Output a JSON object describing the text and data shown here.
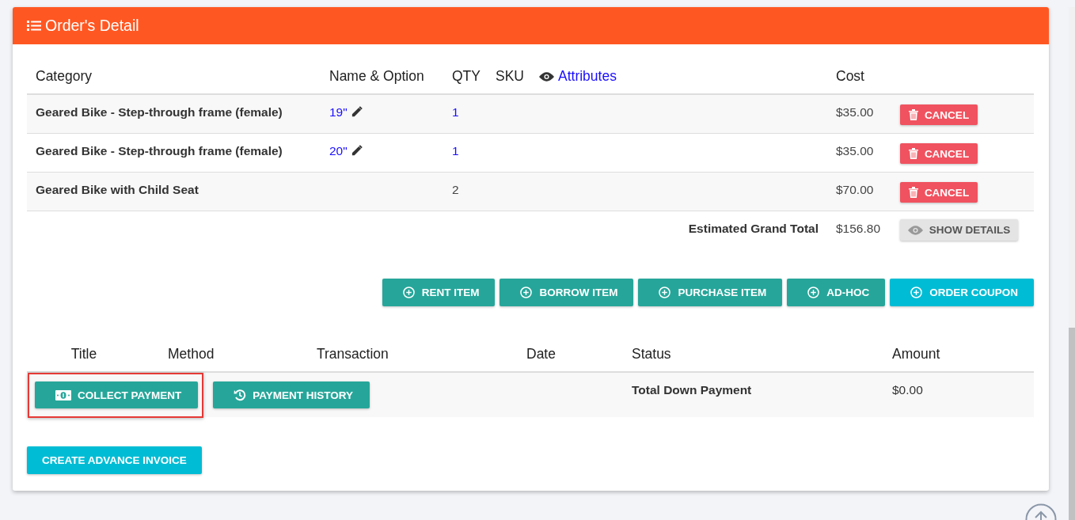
{
  "panel": {
    "title": "Order's Detail"
  },
  "items_table": {
    "columns": [
      {
        "label": "Category",
        "kind": "text"
      },
      {
        "label": "Name & Option",
        "kind": "text"
      },
      {
        "label": "QTY",
        "kind": "text"
      },
      {
        "label": "SKU",
        "kind": "text"
      },
      {
        "label": "Attributes",
        "kind": "link"
      },
      {
        "label": "Cost",
        "kind": "text"
      }
    ],
    "rows": [
      {
        "category": "Geared Bike - Step-through frame (female)",
        "option": "19\"",
        "qty": "1",
        "qty_link": true,
        "cost": "$35.00",
        "action": "CANCEL"
      },
      {
        "category": "Geared Bike - Step-through frame (female)",
        "option": "20\"",
        "qty": "1",
        "qty_link": true,
        "cost": "$35.00",
        "action": "CANCEL"
      },
      {
        "category": "Geared Bike with Child Seat",
        "qty": "2",
        "qty_link": false,
        "cost": "$70.00",
        "action": "CANCEL"
      }
    ],
    "total": {
      "label": "Estimated Grand Total",
      "value": "$156.80",
      "button": "SHOW DETAILS"
    }
  },
  "action_buttons": [
    {
      "label": "RENT ITEM",
      "kind": "primary"
    },
    {
      "label": "BORROW ITEM",
      "kind": "primary"
    },
    {
      "label": "PURCHASE ITEM",
      "kind": "primary"
    },
    {
      "label": "AD-HOC",
      "kind": "primary"
    },
    {
      "label": "ORDER COUPON",
      "kind": "info"
    }
  ],
  "payments_table": {
    "columns": [
      "Title",
      "Method",
      "Transaction",
      "Date",
      "Status",
      "Amount"
    ],
    "row": {
      "buttons": [
        {
          "label": "COLLECT PAYMENT",
          "kind": "money",
          "highlighted": true
        },
        {
          "label": "PAYMENT HISTORY",
          "kind": "history",
          "highlighted": false
        }
      ],
      "status": "Total Down Payment",
      "amount": "$0.00"
    }
  },
  "invoice_button": {
    "label": "CREATE ADVANCE INVOICE"
  }
}
